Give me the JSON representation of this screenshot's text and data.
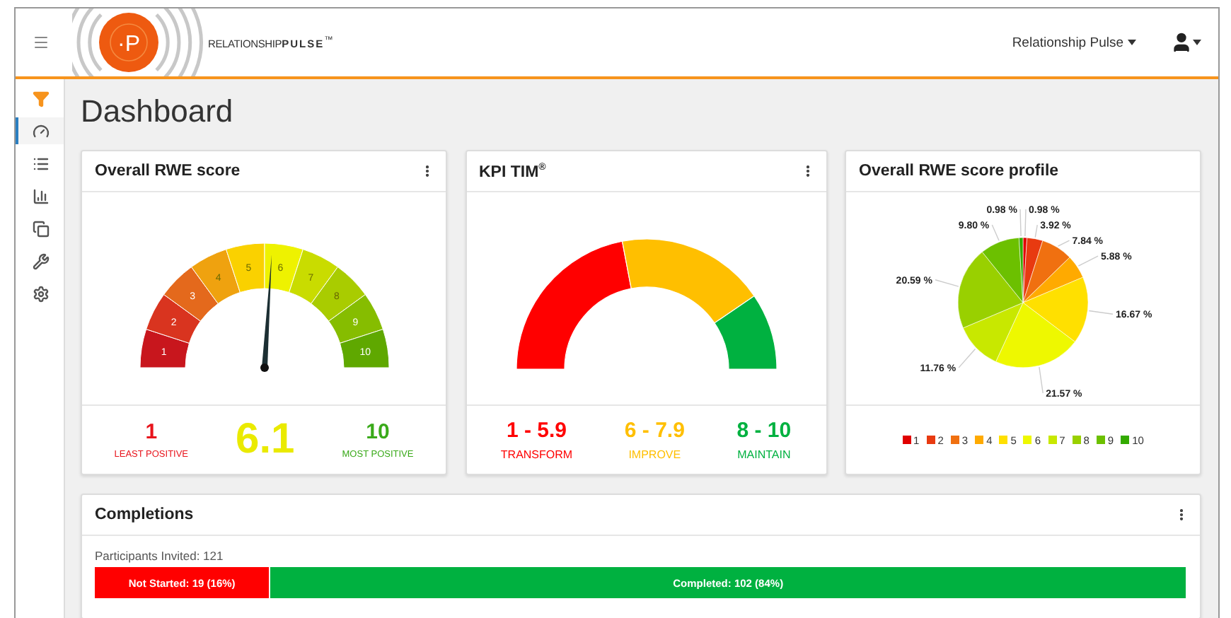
{
  "header": {
    "logo": {
      "mark": "·P",
      "text": "RELATIONSHIP**PULSE**$^{™}$"
    },
    "account_menu": "Relationship Pulse"
  },
  "sidebar": {
    "items": [
      {
        "kind": "filter",
        "selected": false
      },
      {
        "kind": "dashboard",
        "selected": true
      },
      {
        "kind": "list",
        "selected": false
      },
      {
        "kind": "chart",
        "selected": false
      },
      {
        "kind": "copy",
        "selected": false
      },
      {
        "kind": "tools",
        "selected": false
      },
      {
        "kind": "settings",
        "selected": false
      }
    ]
  },
  "page_title": "Dashboard",
  "rwe_score": {
    "title": "Overall RWE score",
    "segments": [
      {
        "label": "1",
        "color": "#c8161d"
      },
      {
        "label": "2",
        "color": "#d9341f"
      },
      {
        "label": "3",
        "color": "#e4691c"
      },
      {
        "label": "4",
        "color": "#efa20f"
      },
      {
        "label": "5",
        "color": "#fad100"
      },
      {
        "label": "6",
        "color": "#eef200"
      },
      {
        "label": "7",
        "color": "#c9dc00"
      },
      {
        "label": "8",
        "color": "#a9cc00"
      },
      {
        "label": "9",
        "color": "#86bd00"
      },
      {
        "label": "10",
        "color": "#5fa800"
      }
    ],
    "stats": [
      {
        "kind": "end",
        "value": "1",
        "caption": "LEAST POSITIVE",
        "color": "#e8141c"
      },
      {
        "kind": "score",
        "value": "6.1",
        "color": "#eaea00"
      },
      {
        "kind": "end",
        "value": "10",
        "caption": "MOST POSITIVE",
        "color": "#3aaa1a"
      }
    ]
  },
  "kpi_tim": {
    "title": "KPI TIM$^{®}$",
    "bands": [
      {
        "range": "1 - 5.9",
        "caption": "TRANSFORM",
        "color": "#ff0000"
      },
      {
        "range": "6 - 7.9",
        "caption": "IMPROVE",
        "color": "#ffbf00"
      },
      {
        "range": "8 - 10",
        "caption": "MAINTAIN",
        "color": "#00b140"
      }
    ]
  },
  "score_profile": {
    "title": "Overall RWE score profile",
    "chart_data": {
      "type": "pie",
      "categories": [
        "1",
        "2",
        "3",
        "4",
        "5",
        "6",
        "7",
        "8",
        "9",
        "10"
      ],
      "values": [
        0.98,
        3.92,
        7.84,
        5.88,
        16.67,
        21.57,
        11.76,
        20.59,
        9.8,
        0.98
      ],
      "value_labels": [
        "0.98 %",
        "3.92 %",
        "7.84 %",
        "5.88 %",
        "16.67 %",
        "21.57 %",
        "11.76 %",
        "20.59 %",
        "9.80 %",
        "0.98 %"
      ]
    },
    "legend": [
      {
        "color": "#e00000"
      },
      {
        "color": "#e83a10"
      },
      {
        "color": "#f07010"
      },
      {
        "color": "#ffaa00"
      },
      {
        "color": "#ffe000"
      },
      {
        "color": "#eef800"
      },
      {
        "color": "#c8e800"
      },
      {
        "color": "#99d000"
      },
      {
        "color": "#6cc000"
      },
      {
        "color": "#33aa00"
      }
    ]
  },
  "completions": {
    "title": "Completions",
    "invited": "Participants Invited: 121",
    "segments": [
      {
        "label": "Not Started: 19 (16%)",
        "color": "#ff0000"
      },
      {
        "label": "Completed: 102 (84%)",
        "color": "#00b140"
      }
    ]
  }
}
